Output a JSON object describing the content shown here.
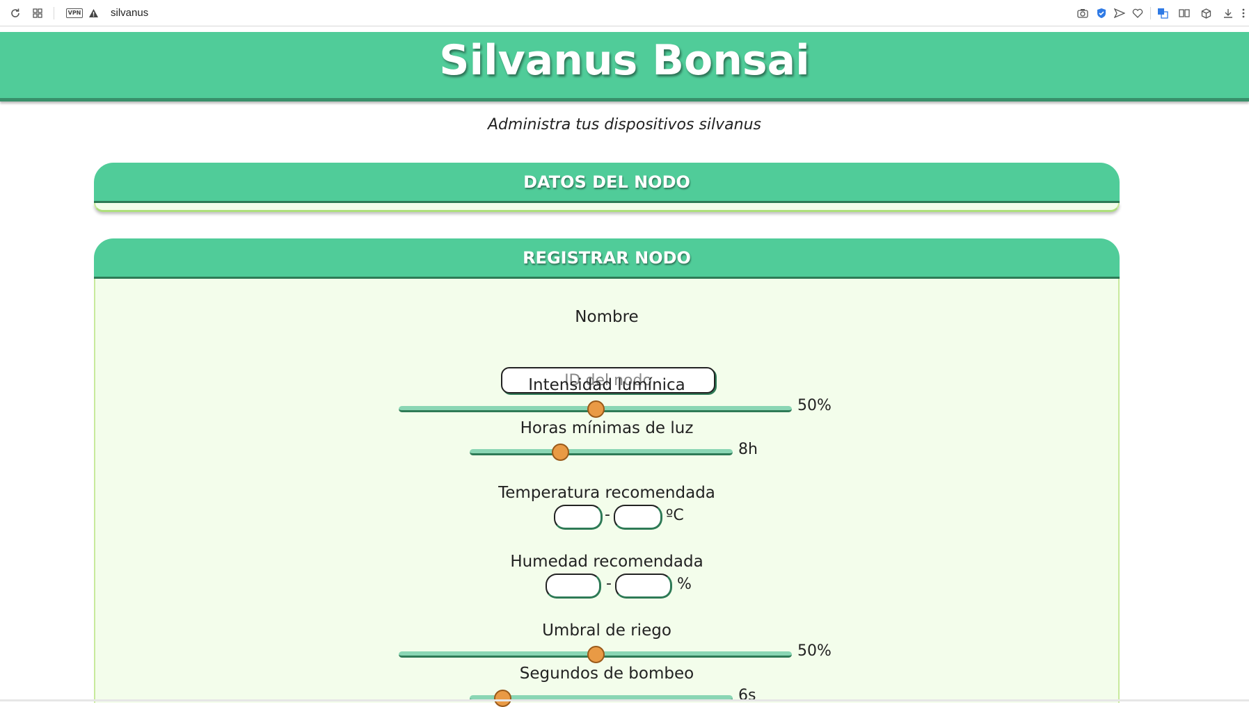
{
  "browser": {
    "vpn_label": "VPN",
    "warning_icon": "warning-icon",
    "url": "silvanus"
  },
  "header": {
    "title": "Silvanus Bonsai",
    "subtitle": "Administra tus dispositivos silvanus"
  },
  "panels": {
    "node_data": {
      "title": "DATOS DEL NODO"
    },
    "register": {
      "title": "REGISTRAR NODO"
    }
  },
  "form": {
    "name": {
      "label": "Nombre",
      "placeholder": "ID del nodo",
      "value": ""
    },
    "light_intensity": {
      "label": "Intensidad lumínica",
      "value": 50,
      "display": "50%"
    },
    "min_light_hours": {
      "label": "Horas mínimas de luz",
      "value": 8,
      "display": "8h"
    },
    "temperature": {
      "label": "Temperatura recomendada",
      "separator": "-",
      "unit": "ºC"
    },
    "humidity": {
      "label": "Humedad recomendada",
      "separator": "-",
      "unit": "%"
    },
    "watering_threshold": {
      "label": "Umbral de riego",
      "value": 50,
      "display": "50%"
    },
    "pump_seconds": {
      "label": "Segundos de bombeo",
      "value": 6,
      "display": "6s"
    }
  },
  "colors": {
    "primary": "#50cc99",
    "primary_dark": "#2e7a56",
    "panel_bg": "#f3fdeb",
    "thumb": "#e99a45"
  }
}
